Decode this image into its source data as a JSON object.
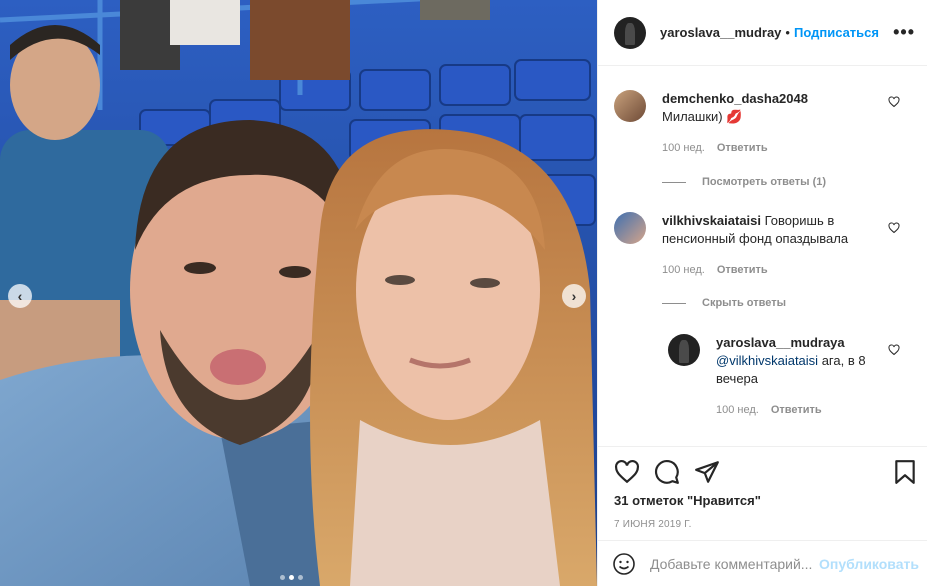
{
  "post": {
    "author": "yaroslava__mudray",
    "separator": "•",
    "follow_label": "Подписаться",
    "more_label": "•••"
  },
  "carousel": {
    "prev_label": "‹",
    "next_label": "›",
    "slide_count": 3,
    "active_slide": 2
  },
  "comments": [
    {
      "username": "demchenko_dasha2048",
      "text": "Милашки)",
      "emoji": "💋",
      "age": "100 нед.",
      "reply_label": "Ответить",
      "replies_toggle": "Посмотреть ответы (1)"
    },
    {
      "username": "vilkhivskaiataisi",
      "text": "Говоришь в пенсионный фонд опаздывала",
      "age": "100 нед.",
      "reply_label": "Ответить",
      "replies_toggle": "Скрыть ответы",
      "replies": [
        {
          "username": "yaroslava__mudraya",
          "mention": "@vilkhivskaiataisi",
          "text": "ага, в 8 вечера",
          "age": "100 нед.",
          "reply_label": "Ответить"
        }
      ]
    }
  ],
  "actions": {
    "likes": "31 отметок \"Нравится\"",
    "date": "7 ИЮНЯ 2019 Г."
  },
  "add_comment": {
    "placeholder": "Добавьте комментарий...",
    "publish_label": "Опубликовать"
  },
  "colors": {
    "accent": "#0095f6",
    "accent_disabled": "#b2dffc",
    "muted_text": "#8e8e8e",
    "border": "#efefef",
    "stadium_blue": "#1f4fb0"
  }
}
